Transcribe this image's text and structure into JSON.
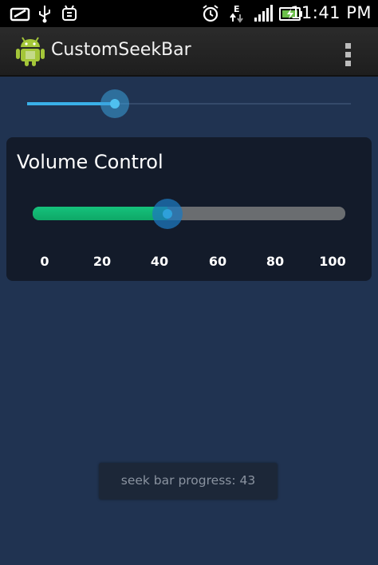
{
  "status_bar": {
    "time": "11:41 PM",
    "icons": [
      "usb-storage-icon",
      "usb-icon",
      "android-debug-icon",
      "alarm-icon",
      "edge-data-icon",
      "signal-icon",
      "battery-charging-icon"
    ]
  },
  "action_bar": {
    "title": "CustomSeekBar",
    "icon": "android-app-icon",
    "overflow_icon": "overflow-menu-icon"
  },
  "top_seekbar": {
    "progress": 0.27,
    "accent": "#3ab0e8"
  },
  "volume_control": {
    "title": "Volume Control",
    "value": 43,
    "max": 100,
    "fill_color": "#15c27c",
    "ticks": [
      "0",
      "20",
      "40",
      "60",
      "80",
      "100"
    ]
  },
  "toast": {
    "text": "seek bar progress: 43"
  },
  "colors": {
    "background": "#203351",
    "card": "#131b2a"
  }
}
